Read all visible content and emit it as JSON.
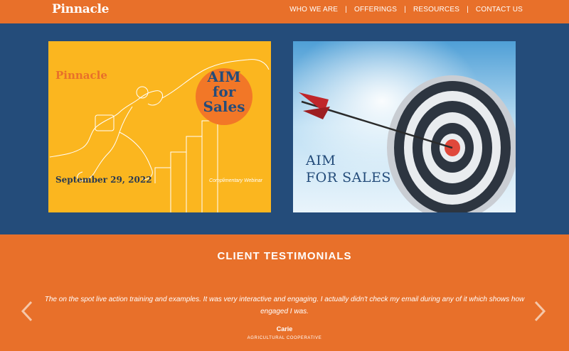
{
  "brand": "Pinnacle",
  "nav": [
    {
      "label": "WHO WE ARE"
    },
    {
      "label": "OFFERINGS"
    },
    {
      "label": "RESOURCES"
    },
    {
      "label": "CONTACT US"
    }
  ],
  "nav_separator": "|",
  "cards": {
    "webinar": {
      "brand": "Pinnacle",
      "title_line1": "AIM",
      "title_line2": "for",
      "title_line3": "Sales",
      "date": "September 29, 2022",
      "subtitle": "Complimentary Webinar"
    },
    "target": {
      "title_line1": "AIM",
      "title_line2": "FOR SALES"
    }
  },
  "testimonials": {
    "heading": "CLIENT TESTIMONIALS",
    "quote": "The on the spot live action training and examples. It was very interactive and engaging. I actually didn't check my email during any of it which shows how engaged I was.",
    "author": "Carie",
    "organization": "AGRICULTURAL COOPERATIVE"
  },
  "colors": {
    "orange": "#e8702a",
    "navy": "#244c7a",
    "yellow": "#fbb61f"
  },
  "icons": {
    "prev": "chevron-left-icon",
    "next": "chevron-right-icon"
  }
}
